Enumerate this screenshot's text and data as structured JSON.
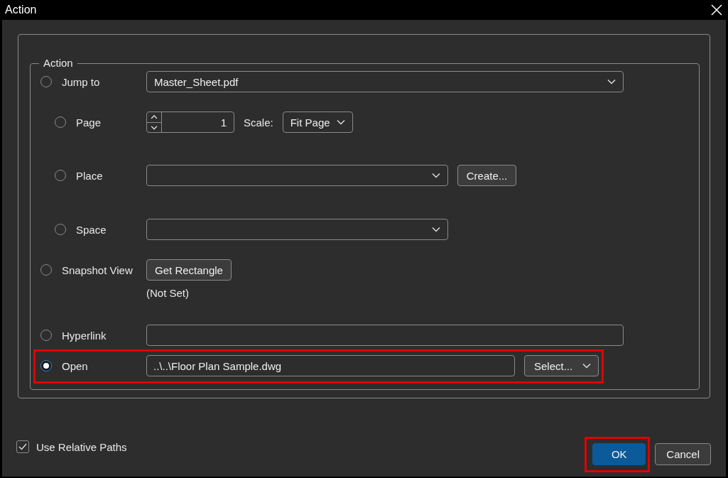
{
  "window": {
    "title": "Action"
  },
  "group": {
    "legend": "Action"
  },
  "options": [
    {
      "label": "Jump to",
      "selected": false,
      "highlighted": false,
      "controls": [
        {
          "kind": "dropdown",
          "value": "Master_Sheet.pdf"
        }
      ],
      "children": [
        {
          "label": "Page",
          "selected": false,
          "highlighted": false,
          "controls": [
            {
              "kind": "spinbox",
              "value": "1"
            },
            {
              "kind": "caption",
              "text": "Scale:"
            },
            {
              "kind": "dropdown",
              "value": "Fit Page"
            }
          ]
        },
        {
          "label": "Place",
          "selected": false,
          "highlighted": false,
          "controls": [
            {
              "kind": "dropdown"
            },
            {
              "kind": "button",
              "label": "Create..."
            }
          ]
        },
        {
          "label": "Space",
          "selected": false,
          "highlighted": false,
          "controls": [
            {
              "kind": "dropdown"
            }
          ]
        }
      ]
    },
    {
      "label": "Snapshot View",
      "selected": false,
      "highlighted": false,
      "controls": [
        {
          "kind": "button",
          "label": "Get Rectangle"
        },
        {
          "kind": "note",
          "text": "(Not Set)"
        }
      ]
    },
    {
      "label": "Hyperlink",
      "selected": false,
      "highlighted": false,
      "controls": [
        {
          "kind": "text"
        }
      ]
    },
    {
      "label": "Open",
      "selected": true,
      "highlighted": true,
      "controls": [
        {
          "kind": "text",
          "value": "..\\..\\Floor Plan Sample.dwg"
        },
        {
          "kind": "select",
          "label": "Select..."
        }
      ]
    }
  ],
  "use_relative_paths": {
    "label": "Use Relative Paths",
    "checked": true
  },
  "buttons": [
    {
      "label": "OK",
      "kind": "primary",
      "highlighted": true
    },
    {
      "label": "Cancel",
      "kind": "default",
      "highlighted": false
    }
  ]
}
